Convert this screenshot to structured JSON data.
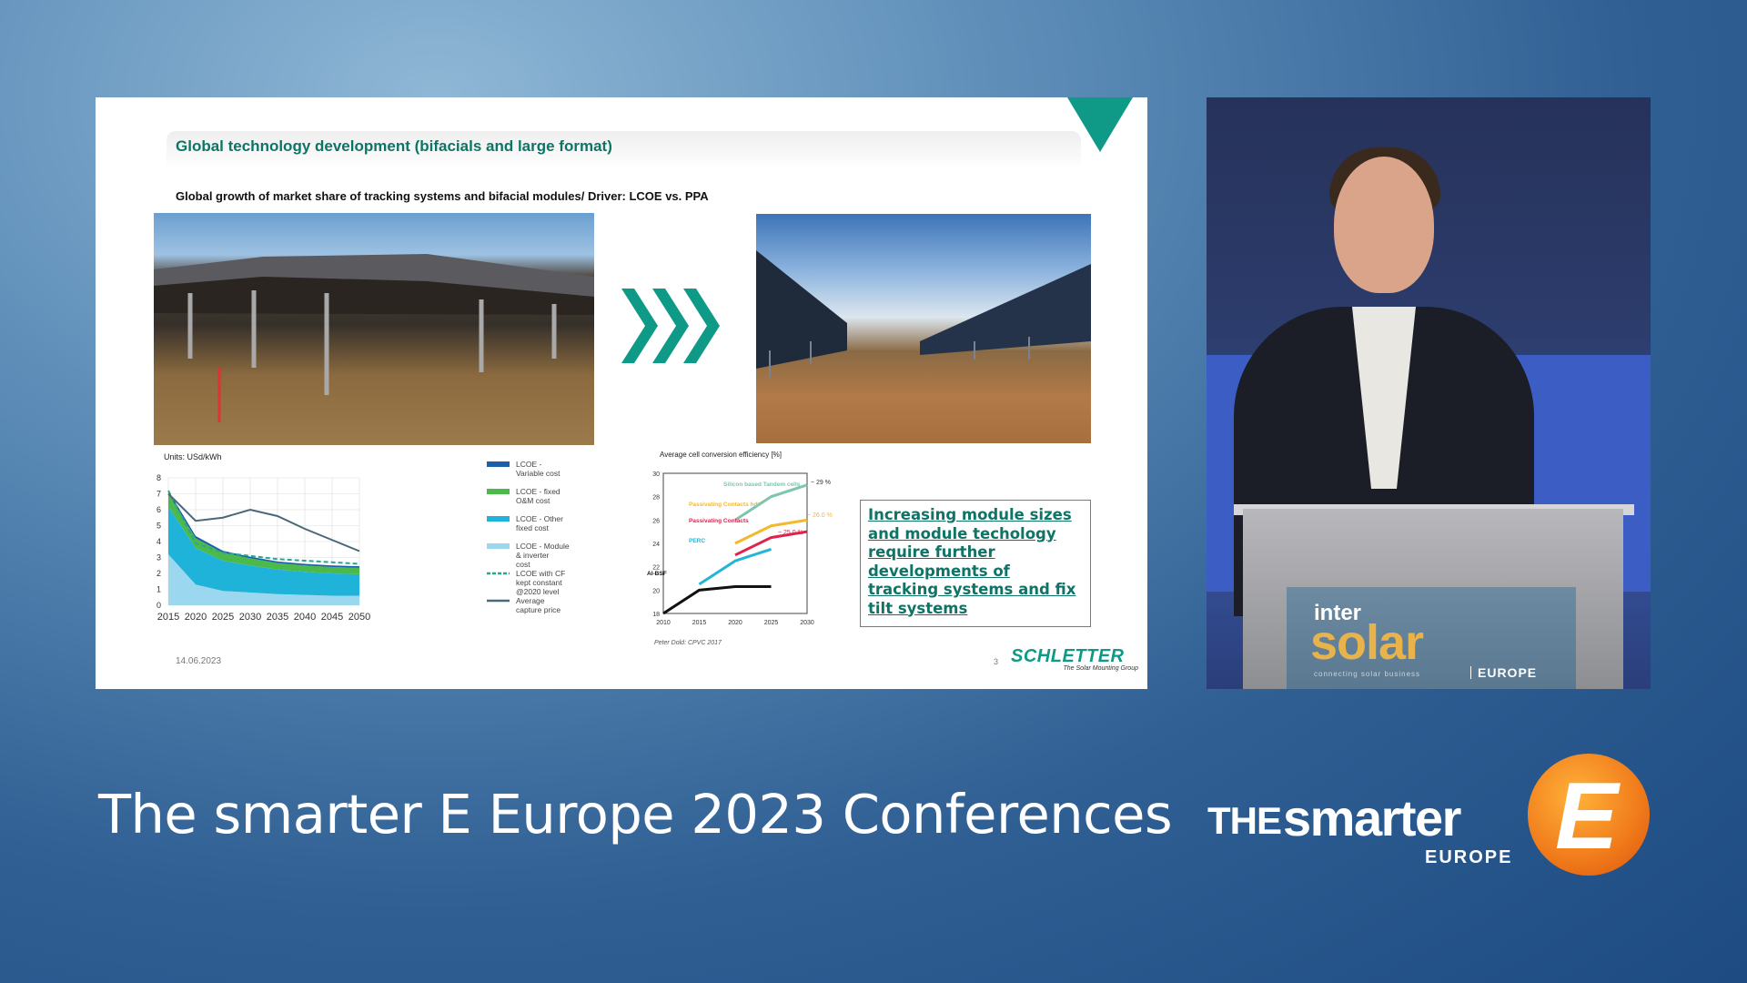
{
  "slide": {
    "title": "Global technology development (bifacials and large format)",
    "subtitle": "Global growth of market share of tracking systems and bifacial modules/ Driver: LCOE vs. PPA",
    "callout": "Increasing module sizes and module techology require further developments of tracking systems and fix tilt systems",
    "date": "14.06.2023",
    "page": "3",
    "brand": "SCHLETTER",
    "brand_tag": "The Solar Mounting Group",
    "accent": "#0e9a86"
  },
  "chart_data": [
    {
      "type": "area",
      "title": "Units: USd/kWh",
      "x": [
        2015,
        2020,
        2025,
        2030,
        2035,
        2040,
        2045,
        2050
      ],
      "ylim": [
        0,
        8
      ],
      "yticks": [
        0,
        1,
        2,
        3,
        4,
        5,
        6,
        7,
        8
      ],
      "series": [
        {
          "name": "LCOE - Variable cost",
          "color": "#1a5fa8",
          "values": [
            0.2,
            0.15,
            0.12,
            0.1,
            0.1,
            0.1,
            0.1,
            0.1
          ]
        },
        {
          "name": "LCOE - fixed O&M cost",
          "color": "#4cba4a",
          "values": [
            0.8,
            0.6,
            0.5,
            0.45,
            0.4,
            0.4,
            0.4,
            0.4
          ]
        },
        {
          "name": "LCOE - Other fixed cost",
          "color": "#1fb3d9",
          "values": [
            3.0,
            2.3,
            1.9,
            1.7,
            1.55,
            1.45,
            1.4,
            1.35
          ]
        },
        {
          "name": "LCOE - Module & inverter cost",
          "color": "#9bd7ee",
          "values": [
            3.2,
            1.3,
            0.9,
            0.8,
            0.7,
            0.65,
            0.6,
            0.6
          ]
        },
        {
          "name": "LCOE with CF kept constant @2020 level",
          "color": "#2aa68e",
          "values": [
            7.2,
            3.9,
            3.3,
            3.1,
            2.9,
            2.8,
            2.7,
            2.6
          ]
        },
        {
          "name": "Average capture price",
          "color": "#4a6878",
          "values": [
            7.0,
            5.3,
            5.5,
            6.0,
            5.6,
            4.8,
            4.1,
            3.4
          ]
        }
      ]
    },
    {
      "type": "line",
      "title": "Average cell conversion efficiency [%]",
      "x": [
        2010,
        2015,
        2020,
        2025,
        2030
      ],
      "ylim": [
        18,
        30
      ],
      "yticks": [
        18,
        20,
        22,
        24,
        26,
        28,
        30
      ],
      "series": [
        {
          "name": "Al-BSF",
          "values": [
            18.0,
            20.0,
            20.3,
            20.3,
            null
          ]
        },
        {
          "name": "PERC",
          "values": [
            null,
            20.5,
            22.5,
            23.5,
            null
          ]
        },
        {
          "name": "Passivating Contacts",
          "values": [
            null,
            null,
            23.0,
            24.5,
            25.0
          ]
        },
        {
          "name": "Passivating Contacts hdt",
          "values": [
            null,
            null,
            24.0,
            25.5,
            26.0
          ]
        },
        {
          "name": "Silicon based Tandem cells",
          "values": [
            null,
            null,
            26.0,
            28.0,
            29.0
          ]
        }
      ],
      "annotations": [
        "~ 29 %",
        "~ 26.0 %",
        "~ 25.0 %"
      ],
      "source": "Peter Dold: CPVC 2017"
    }
  ],
  "video": {
    "event_inter": "inter",
    "event_solar": "solar",
    "event_tag": "connecting solar business",
    "event_region": "EUROPE"
  },
  "footer": {
    "title": "The smarter E Europe 2023 Conferences",
    "brand_the": "THE",
    "brand_smarter": "smarter",
    "brand_europe": "EUROPE",
    "brand_letter": "E"
  }
}
